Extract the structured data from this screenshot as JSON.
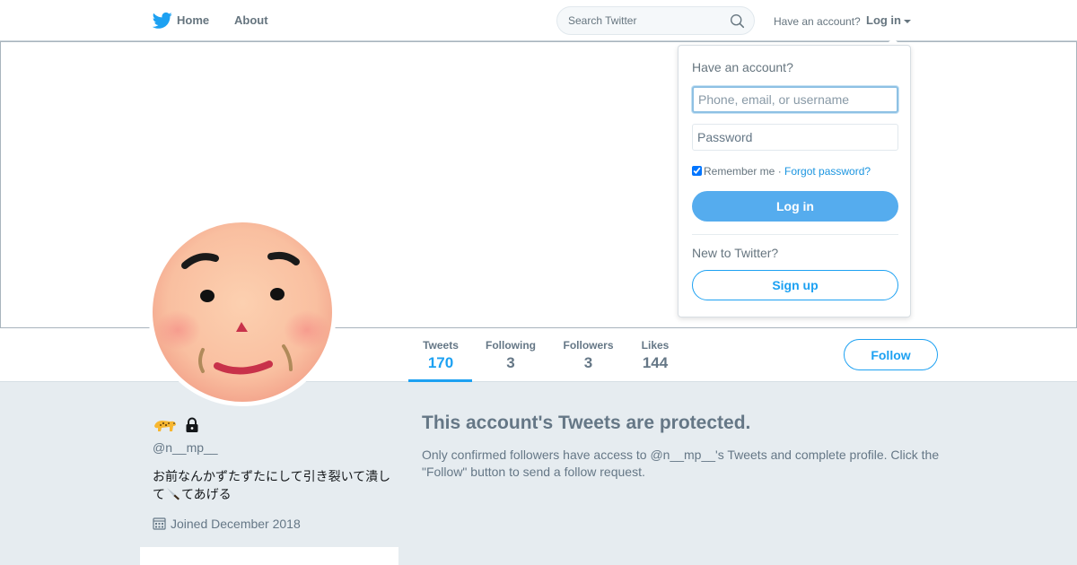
{
  "nav": {
    "home": "Home",
    "about": "About",
    "search_placeholder": "Search Twitter",
    "have_account": "Have an account?",
    "login": "Log in"
  },
  "login_dropdown": {
    "title": "Have an account?",
    "username_placeholder": "Phone, email, or username",
    "password_placeholder": "Password",
    "remember_me": "Remember me",
    "separator": " · ",
    "forgot_password": "Forgot password?",
    "remember_checked": true,
    "login_button": "Log in",
    "new_to_twitter": "New to Twitter?",
    "signup_button": "Sign up"
  },
  "stats": [
    {
      "label": "Tweets",
      "value": "170",
      "active": true
    },
    {
      "label": "Following",
      "value": "3",
      "active": false
    },
    {
      "label": "Followers",
      "value": "3",
      "active": false
    },
    {
      "label": "Likes",
      "value": "144",
      "active": false
    }
  ],
  "follow_button": "Follow",
  "profile": {
    "handle": "@n__mp__",
    "bio_before": "お前なんかずたずたにして引き裂いて潰して",
    "bio_after": "てあげる",
    "joined": "Joined December 2018"
  },
  "protected": {
    "title": "This account's Tweets are protected.",
    "description": "Only confirmed followers have access to @n__mp__'s Tweets and complete profile. Click the \"Follow\" button to send a follow request."
  },
  "colors": {
    "accent": "#1da1f2",
    "login_button": "#55acee",
    "background": "#e6ecf0"
  }
}
